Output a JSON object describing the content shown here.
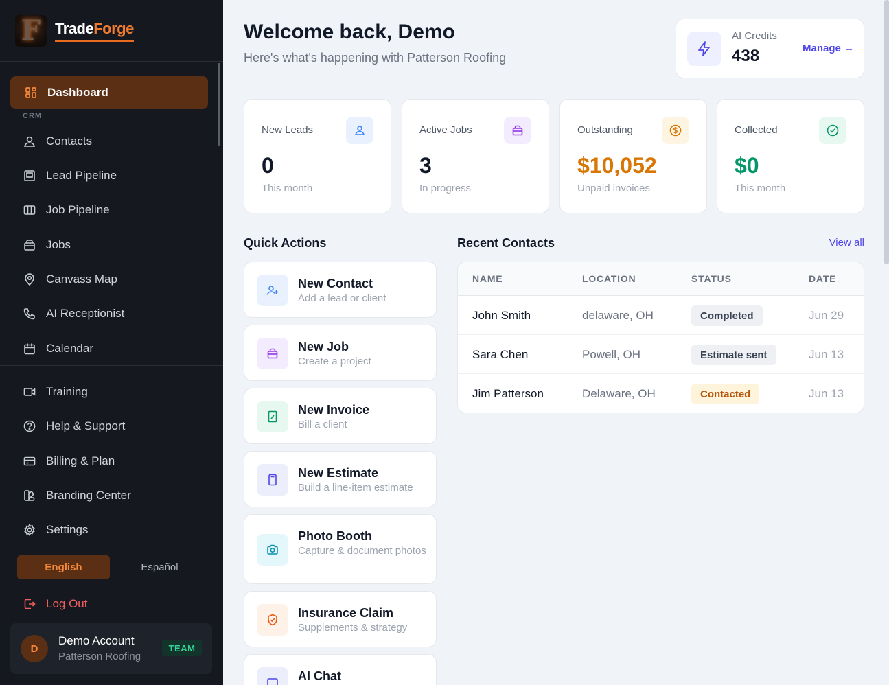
{
  "brand": {
    "logo_letter": "F",
    "name_part1": "Trade",
    "name_part2": "Forge"
  },
  "sidebar": {
    "active": {
      "label": "Dashboard",
      "icon": "grid-icon"
    },
    "section_label": "CRM",
    "items": [
      {
        "label": "Contacts",
        "icon": "users-icon"
      },
      {
        "label": "Lead Pipeline",
        "icon": "kanban-icon"
      },
      {
        "label": "Job Pipeline",
        "icon": "columns-icon"
      },
      {
        "label": "Jobs",
        "icon": "toolbox-icon"
      },
      {
        "label": "Canvass Map",
        "icon": "map-pin-icon"
      },
      {
        "label": "AI Receptionist",
        "icon": "phone-icon"
      },
      {
        "label": "Calendar",
        "icon": "calendar-icon"
      }
    ],
    "secondary_items": [
      {
        "label": "Training",
        "icon": "video-icon"
      },
      {
        "label": "Help & Support",
        "icon": "help-circle-icon"
      },
      {
        "label": "Billing & Plan",
        "icon": "credit-card-icon"
      },
      {
        "label": "Branding Center",
        "icon": "palette-icon"
      },
      {
        "label": "Settings",
        "icon": "gear-icon"
      }
    ],
    "languages": {
      "selected": "English",
      "other": "Español"
    },
    "logout_label": "Log Out",
    "account": {
      "initial": "D",
      "name": "Demo Account",
      "org": "Patterson Roofing",
      "badge": "TEAM"
    }
  },
  "header": {
    "title": "Welcome back, Demo",
    "subtitle": "Here's what's happening with Patterson Roofing"
  },
  "credits": {
    "label": "AI Credits",
    "value": "438",
    "manage_label": "Manage →"
  },
  "stats": [
    {
      "label": "New Leads",
      "value": "0",
      "sub": "This month",
      "icon": "users-icon",
      "color": "#111827"
    },
    {
      "label": "Active Jobs",
      "value": "3",
      "sub": "In progress",
      "icon": "toolbox-icon",
      "color": "#111827"
    },
    {
      "label": "Outstanding",
      "value": "$10,052",
      "sub": "Unpaid invoices",
      "icon": "dollar-icon",
      "color": "#d97706"
    },
    {
      "label": "Collected",
      "value": "$0",
      "sub": "This month",
      "icon": "check-circle-icon",
      "color": "#059669"
    }
  ],
  "quick_actions": {
    "heading": "Quick Actions",
    "items": [
      {
        "title": "New Contact",
        "sub": "Add a lead or client",
        "icon": "user-plus-icon"
      },
      {
        "title": "New Job",
        "sub": "Create a project",
        "icon": "toolbox-icon"
      },
      {
        "title": "New Invoice",
        "sub": "Bill a client",
        "icon": "receipt-icon"
      },
      {
        "title": "New Estimate",
        "sub": "Build a line-item estimate",
        "icon": "calculator-icon"
      },
      {
        "title": "Photo Booth",
        "sub": "Capture & document photos",
        "icon": "camera-icon"
      },
      {
        "title": "Insurance Claim",
        "sub": "Supplements & strategy",
        "icon": "shield-icon"
      },
      {
        "title": "AI Chat",
        "sub": "",
        "icon": "chat-icon"
      }
    ]
  },
  "recent_contacts": {
    "heading": "Recent Contacts",
    "view_all": "View all",
    "columns": [
      "NAME",
      "LOCATION",
      "STATUS",
      "DATE"
    ],
    "rows": [
      {
        "name": "John Smith",
        "location": "delaware, OH",
        "status": "Completed",
        "date": "Jun 29"
      },
      {
        "name": "Sara Chen",
        "location": "Powell, OH",
        "status": "Estimate sent",
        "date": "Jun 13"
      },
      {
        "name": "Jim Patterson",
        "location": "Delaware, OH",
        "status": "Contacted",
        "date": "Jun 13"
      }
    ]
  }
}
